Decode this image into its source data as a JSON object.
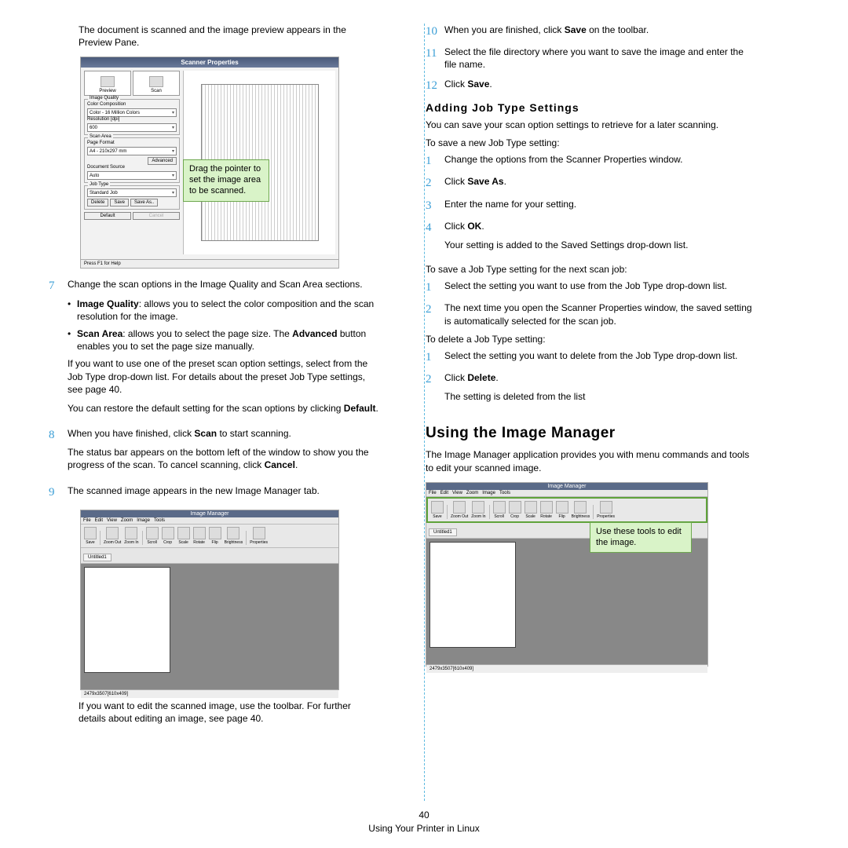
{
  "left": {
    "intro": "The document is scanned and the image preview appears in the Preview Pane.",
    "sp": {
      "title": "Scanner Properties",
      "tab_preview": "Preview",
      "tab_scan": "Scan",
      "group_image_quality": "Image Quality",
      "color_comp_label": "Color Composition",
      "color_comp_val": "Color - 16 Million Colors",
      "res_label": "Resolution [dpi]",
      "res_val": "600",
      "group_scan_area": "Scan Area",
      "page_format_label": "Page Format",
      "page_format_val": "A4 - 210x297 mm",
      "advanced_btn": "Advanced",
      "doc_source_label": "Document Source",
      "doc_source_val": "Auto",
      "group_job_type": "Job Type",
      "job_type_val": "Standard Job",
      "delete_btn": "Delete",
      "save_btn": "Save",
      "saveas_btn": "Save As..",
      "default_btn": "Default",
      "cancel_btn": "Cancel",
      "status": "Press F1 for Help"
    },
    "callout_drag": "Drag the pointer to set the image area to be scanned.",
    "step7": {
      "num": "7",
      "text": "Change the scan options in the Image Quality and Scan Area sections.",
      "b1_lead": "Image Quality",
      "b1_rest": ": allows you to select the color composition and the scan resolution for the image.",
      "b2_lead": "Scan Area",
      "b2_rest": ": allows you to select the page size. The ",
      "b2_bold": "Advanced",
      "b2_tail": " button enables you to set the page size manually.",
      "p1": "If you want to use one of the preset scan option settings, select from the Job Type drop-down list. For details about the preset Job Type settings, see page 40.",
      "p2a": "You can restore the default setting for the scan options by clicking ",
      "p2b": "Default",
      "p2c": "."
    },
    "step8": {
      "num": "8",
      "text1": "When you have finished, click ",
      "bold": "Scan",
      "text2": " to start scanning.",
      "p1": "The status bar appears on the bottom left of the window to show you the progress of the scan. To cancel scanning, click ",
      "p1b": "Cancel",
      "p1c": "."
    },
    "step9": {
      "num": "9",
      "text": "The scanned image appears in the new Image Manager tab."
    },
    "im": {
      "title": "Image Manager",
      "menu": {
        "file": "File",
        "edit": "Edit",
        "view": "View",
        "zoom": "Zoom",
        "image": "Image",
        "tools": "Tools"
      },
      "tools": {
        "save": "Save",
        "zoomout": "Zoom Out",
        "zoomin": "Zoom In",
        "scroll": "Scroll",
        "crop": "Crop",
        "scale": "Scale",
        "rotate": "Rotate",
        "flip": "Flip",
        "brightness": "Brightness",
        "properties": "Properties"
      },
      "tab": "Untitled1",
      "status": "2479x3507[610x409]"
    },
    "after_im": "If you want to edit the scanned image, use the toolbar. For further details about editing an image, see page 40."
  },
  "right": {
    "step10": {
      "num": "10",
      "a": "When you are finished, click ",
      "b": "Save",
      "c": " on the toolbar."
    },
    "step11": {
      "num": "11",
      "text": "Select the file directory where you want to save the image and enter the file name."
    },
    "step12": {
      "num": "12",
      "a": "Click ",
      "b": "Save",
      "c": "."
    },
    "h3": "Adding Job Type Settings",
    "p1": "You can save your scan option settings to retrieve for a later scanning.",
    "p2": "To save a new Job Type setting:",
    "save_list": [
      {
        "num": "1",
        "text": "Change the options from the Scanner Properties window."
      },
      {
        "num": "2",
        "a": "Click ",
        "b": "Save As",
        "c": "."
      },
      {
        "num": "3",
        "text": "Enter the name for your setting."
      },
      {
        "num": "4",
        "a": "Click ",
        "b": "OK",
        "c": ".",
        "after": "Your setting is added to the Saved Settings drop-down list."
      }
    ],
    "p3": "To save a Job Type setting for the next scan job:",
    "next_list": [
      {
        "num": "1",
        "text": "Select the setting you want to use from the Job Type drop-down list."
      },
      {
        "num": "2",
        "text": "The next time you open the Scanner Properties window, the saved setting is automatically selected for the scan job."
      }
    ],
    "p4": "To delete a Job Type setting:",
    "del_list": [
      {
        "num": "1",
        "text": "Select the setting you want to delete from the Job Type drop-down list."
      },
      {
        "num": "2",
        "a": "Click ",
        "b": "Delete",
        "c": ".",
        "after": "The setting is deleted from the list"
      }
    ],
    "h2": "Using the Image Manager",
    "h2p": "The Image Manager application provides you with menu commands and tools to edit your scanned image.",
    "callout_tools": "Use these tools to edit the image."
  },
  "footer": {
    "page": "40",
    "title": "Using Your Printer in Linux"
  }
}
